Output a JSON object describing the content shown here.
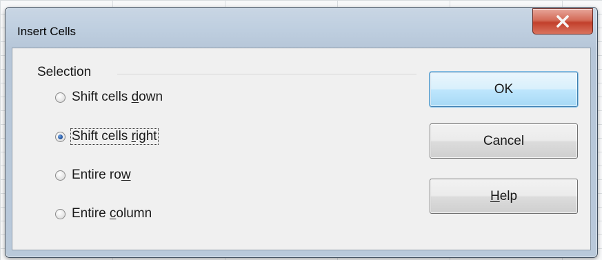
{
  "dialog": {
    "title": "Insert Cells",
    "close_glyph": "X"
  },
  "selection": {
    "label": "Selection",
    "options": [
      {
        "pre": "Shift cells ",
        "ul": "d",
        "post": "own",
        "checked": false
      },
      {
        "pre": "Shift cells ",
        "ul": "r",
        "post": "ight",
        "checked": true
      },
      {
        "pre": "Entire ro",
        "ul": "w",
        "post": "",
        "checked": false
      },
      {
        "pre": "Entire ",
        "ul": "c",
        "post": "olumn",
        "checked": false
      }
    ]
  },
  "buttons": {
    "ok": "OK",
    "cancel": "Cancel",
    "help_ul": "H",
    "help_rest": "elp"
  },
  "icons": {
    "close": "close-icon",
    "radio": "radio-button-icon"
  },
  "colors": {
    "close_button": "#c2402c",
    "default_button_border": "#3c7fb1",
    "selected_radio": "#1d4f9c"
  }
}
